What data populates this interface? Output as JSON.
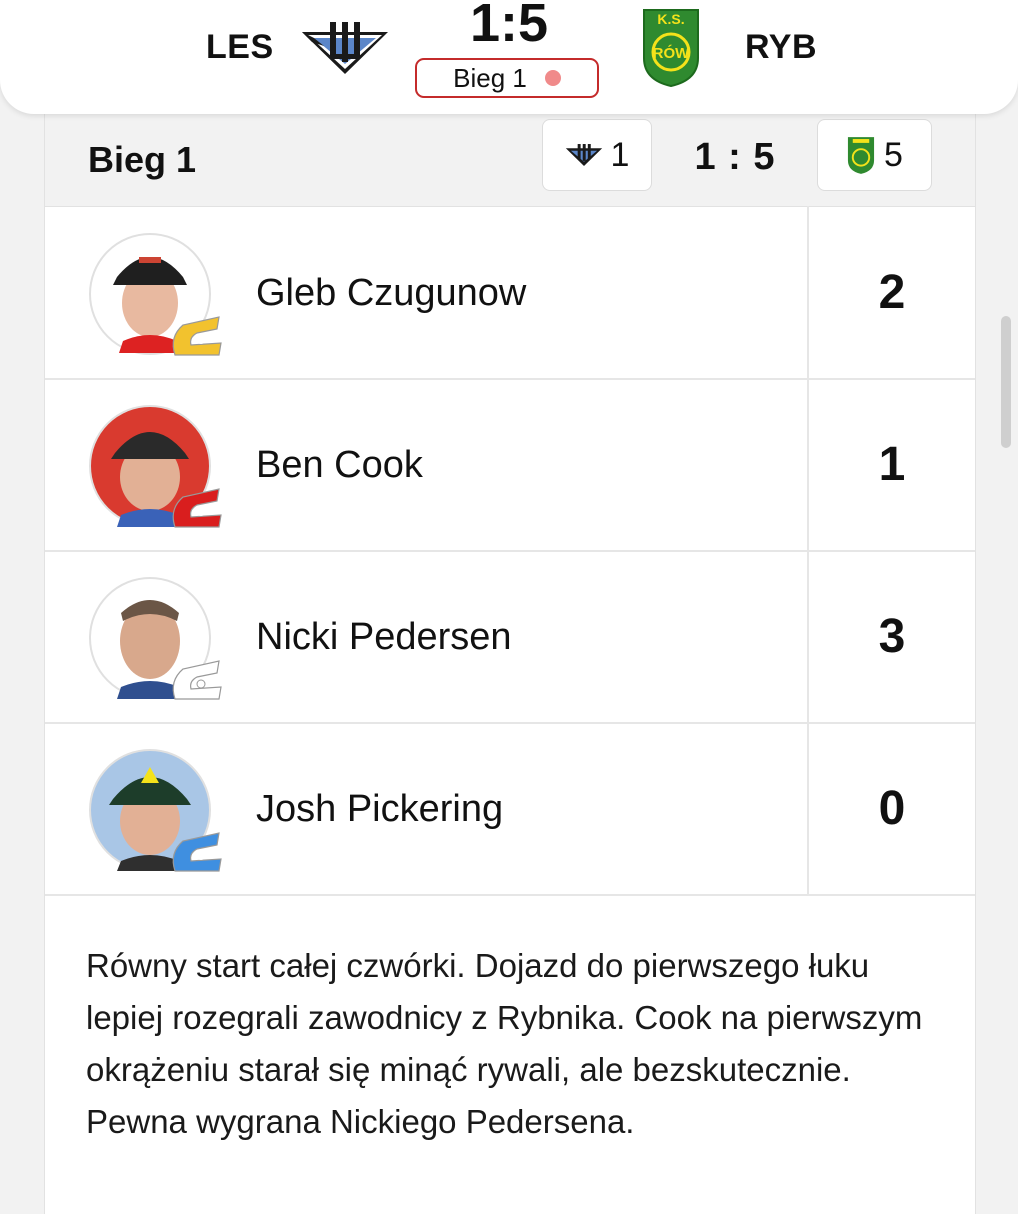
{
  "header": {
    "home_abbr": "LES",
    "away_abbr": "RYB",
    "score": "1:5",
    "heat_label": "Bieg 1"
  },
  "heat": {
    "title": "Bieg 1",
    "home_points": "1",
    "away_points": "5",
    "score": "1 : 5"
  },
  "riders": [
    {
      "name": "Gleb Czugunow",
      "points": "2",
      "helmet_color": "#f2c22e"
    },
    {
      "name": "Ben Cook",
      "points": "1",
      "helmet_color": "#d91e1e"
    },
    {
      "name": "Nicki Pedersen",
      "points": "3",
      "helmet_color": "#ffffff"
    },
    {
      "name": "Josh Pickering",
      "points": "0",
      "helmet_color": "#3f8fe0"
    }
  ],
  "commentary": "Równy start całej czwórki. Dojazd do pierwszego łuku lepiej rozegrali zawodnicy z Rybnika. Cook na pierwszym okrążeniu starał się minąć rywali, ale bezskutecznie. Pewna wygrana Nickiego Pedersena.",
  "away_logo_text": "K.S. ROW RYBNIK",
  "colors": {
    "live_red": "#c42b2b",
    "away_green": "#2f8a2f",
    "away_yellow": "#f4e21a"
  }
}
